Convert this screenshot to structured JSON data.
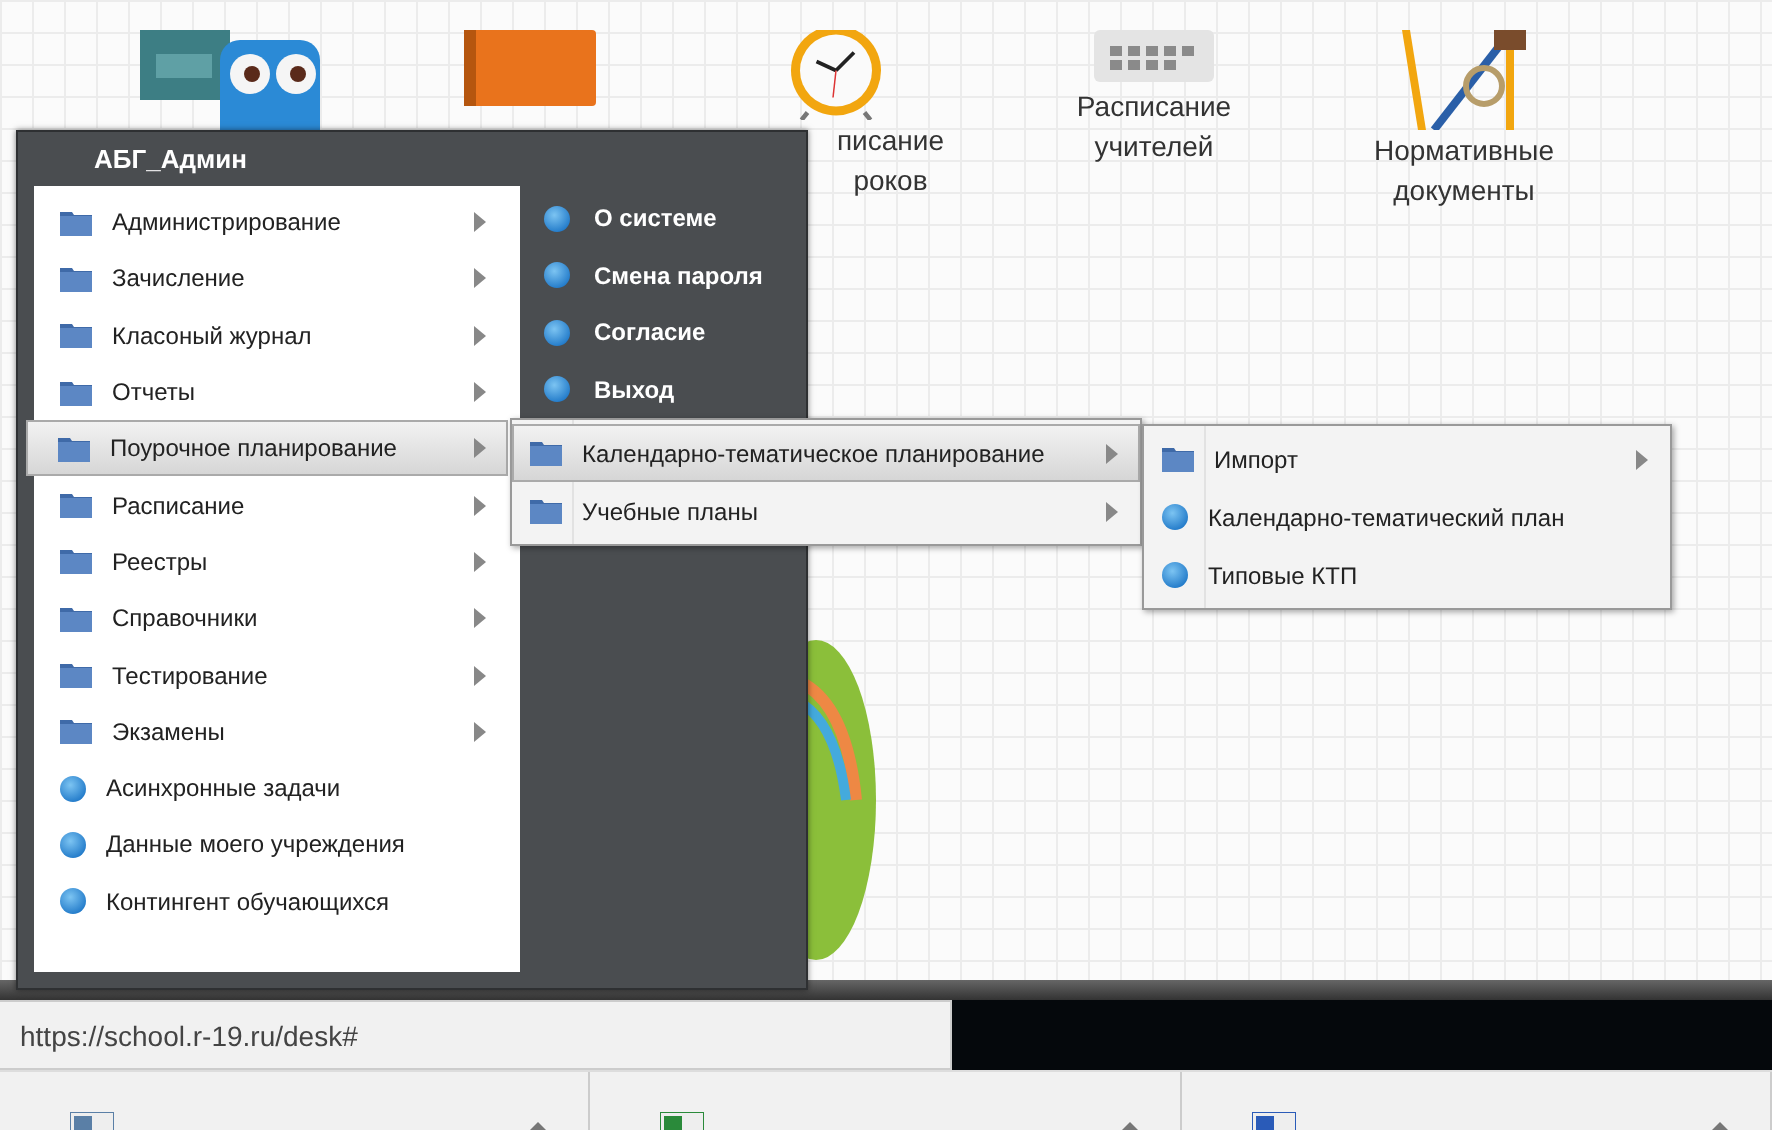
{
  "desktop": [
    {
      "kind": "robot"
    },
    {
      "kind": "notebook"
    },
    {
      "kind": "clock",
      "lines": [
        "писание",
        "роков"
      ]
    },
    {
      "kind": "calendar",
      "lines": [
        "Расписание",
        "учителей"
      ]
    },
    {
      "kind": "pen",
      "lines": [
        "Нормативные",
        "документы"
      ]
    }
  ],
  "menu": {
    "user": "АБГ_Админ",
    "items": [
      {
        "label": "Администрирование",
        "kind": "folder",
        "selected": false
      },
      {
        "label": "Зачисление",
        "kind": "folder",
        "selected": false
      },
      {
        "label": "Класоный журнал",
        "kind": "folder",
        "selected": false
      },
      {
        "label": "Отчеты",
        "kind": "folder",
        "selected": false
      },
      {
        "label": "Поурочное планирование",
        "kind": "folder",
        "selected": true
      },
      {
        "label": "Расписание",
        "kind": "folder",
        "selected": false
      },
      {
        "label": "Реестры",
        "kind": "folder",
        "selected": false
      },
      {
        "label": "Справочники",
        "kind": "folder",
        "selected": false
      },
      {
        "label": "Тестирование",
        "kind": "folder",
        "selected": false
      },
      {
        "label": "Экзамены",
        "kind": "folder",
        "selected": false
      },
      {
        "label": "Асинхронные задачи",
        "kind": "item",
        "selected": false
      },
      {
        "label": "Данные моего учреждения",
        "kind": "item",
        "selected": false
      },
      {
        "label": "Контингент обучающихся",
        "kind": "item",
        "selected": false
      }
    ],
    "side": [
      "О системе",
      "Смена пароля",
      "Согласие",
      "Выход"
    ]
  },
  "submenu": [
    {
      "label": "Календарно-тематическое планирование",
      "kind": "folder",
      "selected": true
    },
    {
      "label": "Учебные планы",
      "kind": "folder",
      "selected": false
    }
  ],
  "submenu2": [
    {
      "label": "Импорт",
      "kind": "folder",
      "selected": false
    },
    {
      "label": "Календарно-тематический план",
      "kind": "item",
      "selected": false
    },
    {
      "label": "Типовые КТП",
      "kind": "item",
      "selected": false
    }
  ],
  "status_url": "https://school.r-19.ru/desk#",
  "downloads": [
    {
      "kind": "zip"
    },
    {
      "kind": "excel"
    },
    {
      "kind": "word"
    }
  ]
}
